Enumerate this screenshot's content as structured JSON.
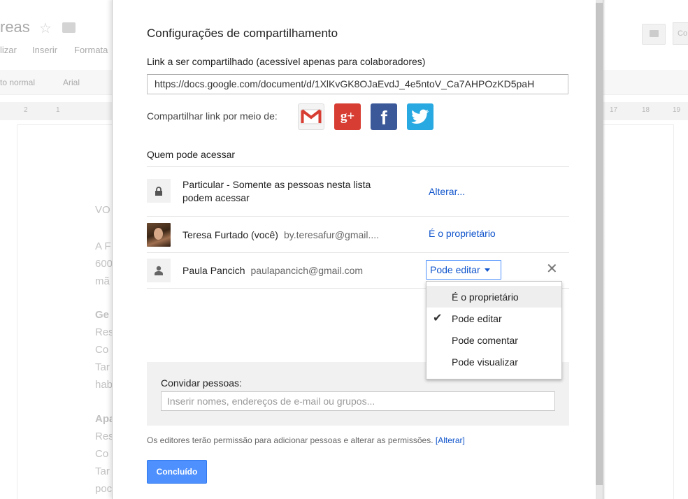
{
  "background": {
    "doc_title_fragment": "reas",
    "menu_items": [
      "lizar",
      "Inserir",
      "Formata"
    ],
    "toolbar": {
      "style": "to normal",
      "font": "Arial"
    },
    "ruler_left": [
      "2",
      "1"
    ],
    "ruler_right": [
      "17",
      "18",
      "19"
    ],
    "share_fragment": "Co",
    "doc_lines": [
      {
        "text": "VO",
        "bold": false
      },
      {
        "text": "A F",
        "bold": false
      },
      {
        "text": "600",
        "bold": false
      },
      {
        "text": "mã",
        "bold": false
      },
      {
        "text": "Ge",
        "bold": true
      },
      {
        "text": "Res",
        "bold": false
      },
      {
        "text": "Co",
        "bold": false
      },
      {
        "text": "Tar",
        "bold": false
      },
      {
        "text": "hab",
        "bold": false
      },
      {
        "text": "Apa",
        "bold": true
      },
      {
        "text": "Res",
        "bold": false
      },
      {
        "text": "Co",
        "bold": false
      },
      {
        "text": "Tar",
        "bold": false
      },
      {
        "text": "poc",
        "bold": false
      }
    ]
  },
  "dialog": {
    "title": "Configurações de compartilhamento",
    "link_label": "Link a ser compartilhado (acessível apenas para colaboradores)",
    "link_value": "https://docs.google.com/document/d/1XlKvGK8OJaEvdJ_4e5ntoV_Ca7AHPOzKD5paH",
    "share_via_label": "Compartilhar link por meio de:",
    "social_icons": [
      "gmail-icon",
      "google-plus-icon",
      "facebook-icon",
      "twitter-icon"
    ],
    "who_label": "Quem pode acessar",
    "access_rows": [
      {
        "icon": "lock-icon",
        "line1": "Particular - Somente as pessoas nesta lista",
        "line2": "podem acessar",
        "action": "Alterar..."
      },
      {
        "icon": "avatar",
        "name": "Teresa Furtado (você)",
        "email": "by.teresafur@gmail....",
        "action": "É o proprietário"
      },
      {
        "icon": "person-icon",
        "name": "Paula Pancich",
        "email": "paulapancich@gmail.com",
        "action": "Pode editar"
      }
    ],
    "permission_menu": {
      "items": [
        "É o proprietário",
        "Pode editar",
        "Pode comentar",
        "Pode visualizar"
      ],
      "selected": "Pode editar",
      "hovered": "É o proprietário"
    },
    "remove_symbol": "✕",
    "invite_label": "Convidar pessoas:",
    "invite_placeholder": "Inserir nomes, endereços de e-mail ou grupos...",
    "note": "Os editores terão permissão para adicionar pessoas e alterar as permissões.",
    "note_link": "[Alterar]",
    "done_button": "Concluído",
    "colors": {
      "link_blue": "#1155cc",
      "button_blue": "#4d90fe",
      "gplus_red": "#d73d32",
      "facebook_blue": "#3b5998",
      "twitter_blue": "#29a9e1"
    }
  }
}
